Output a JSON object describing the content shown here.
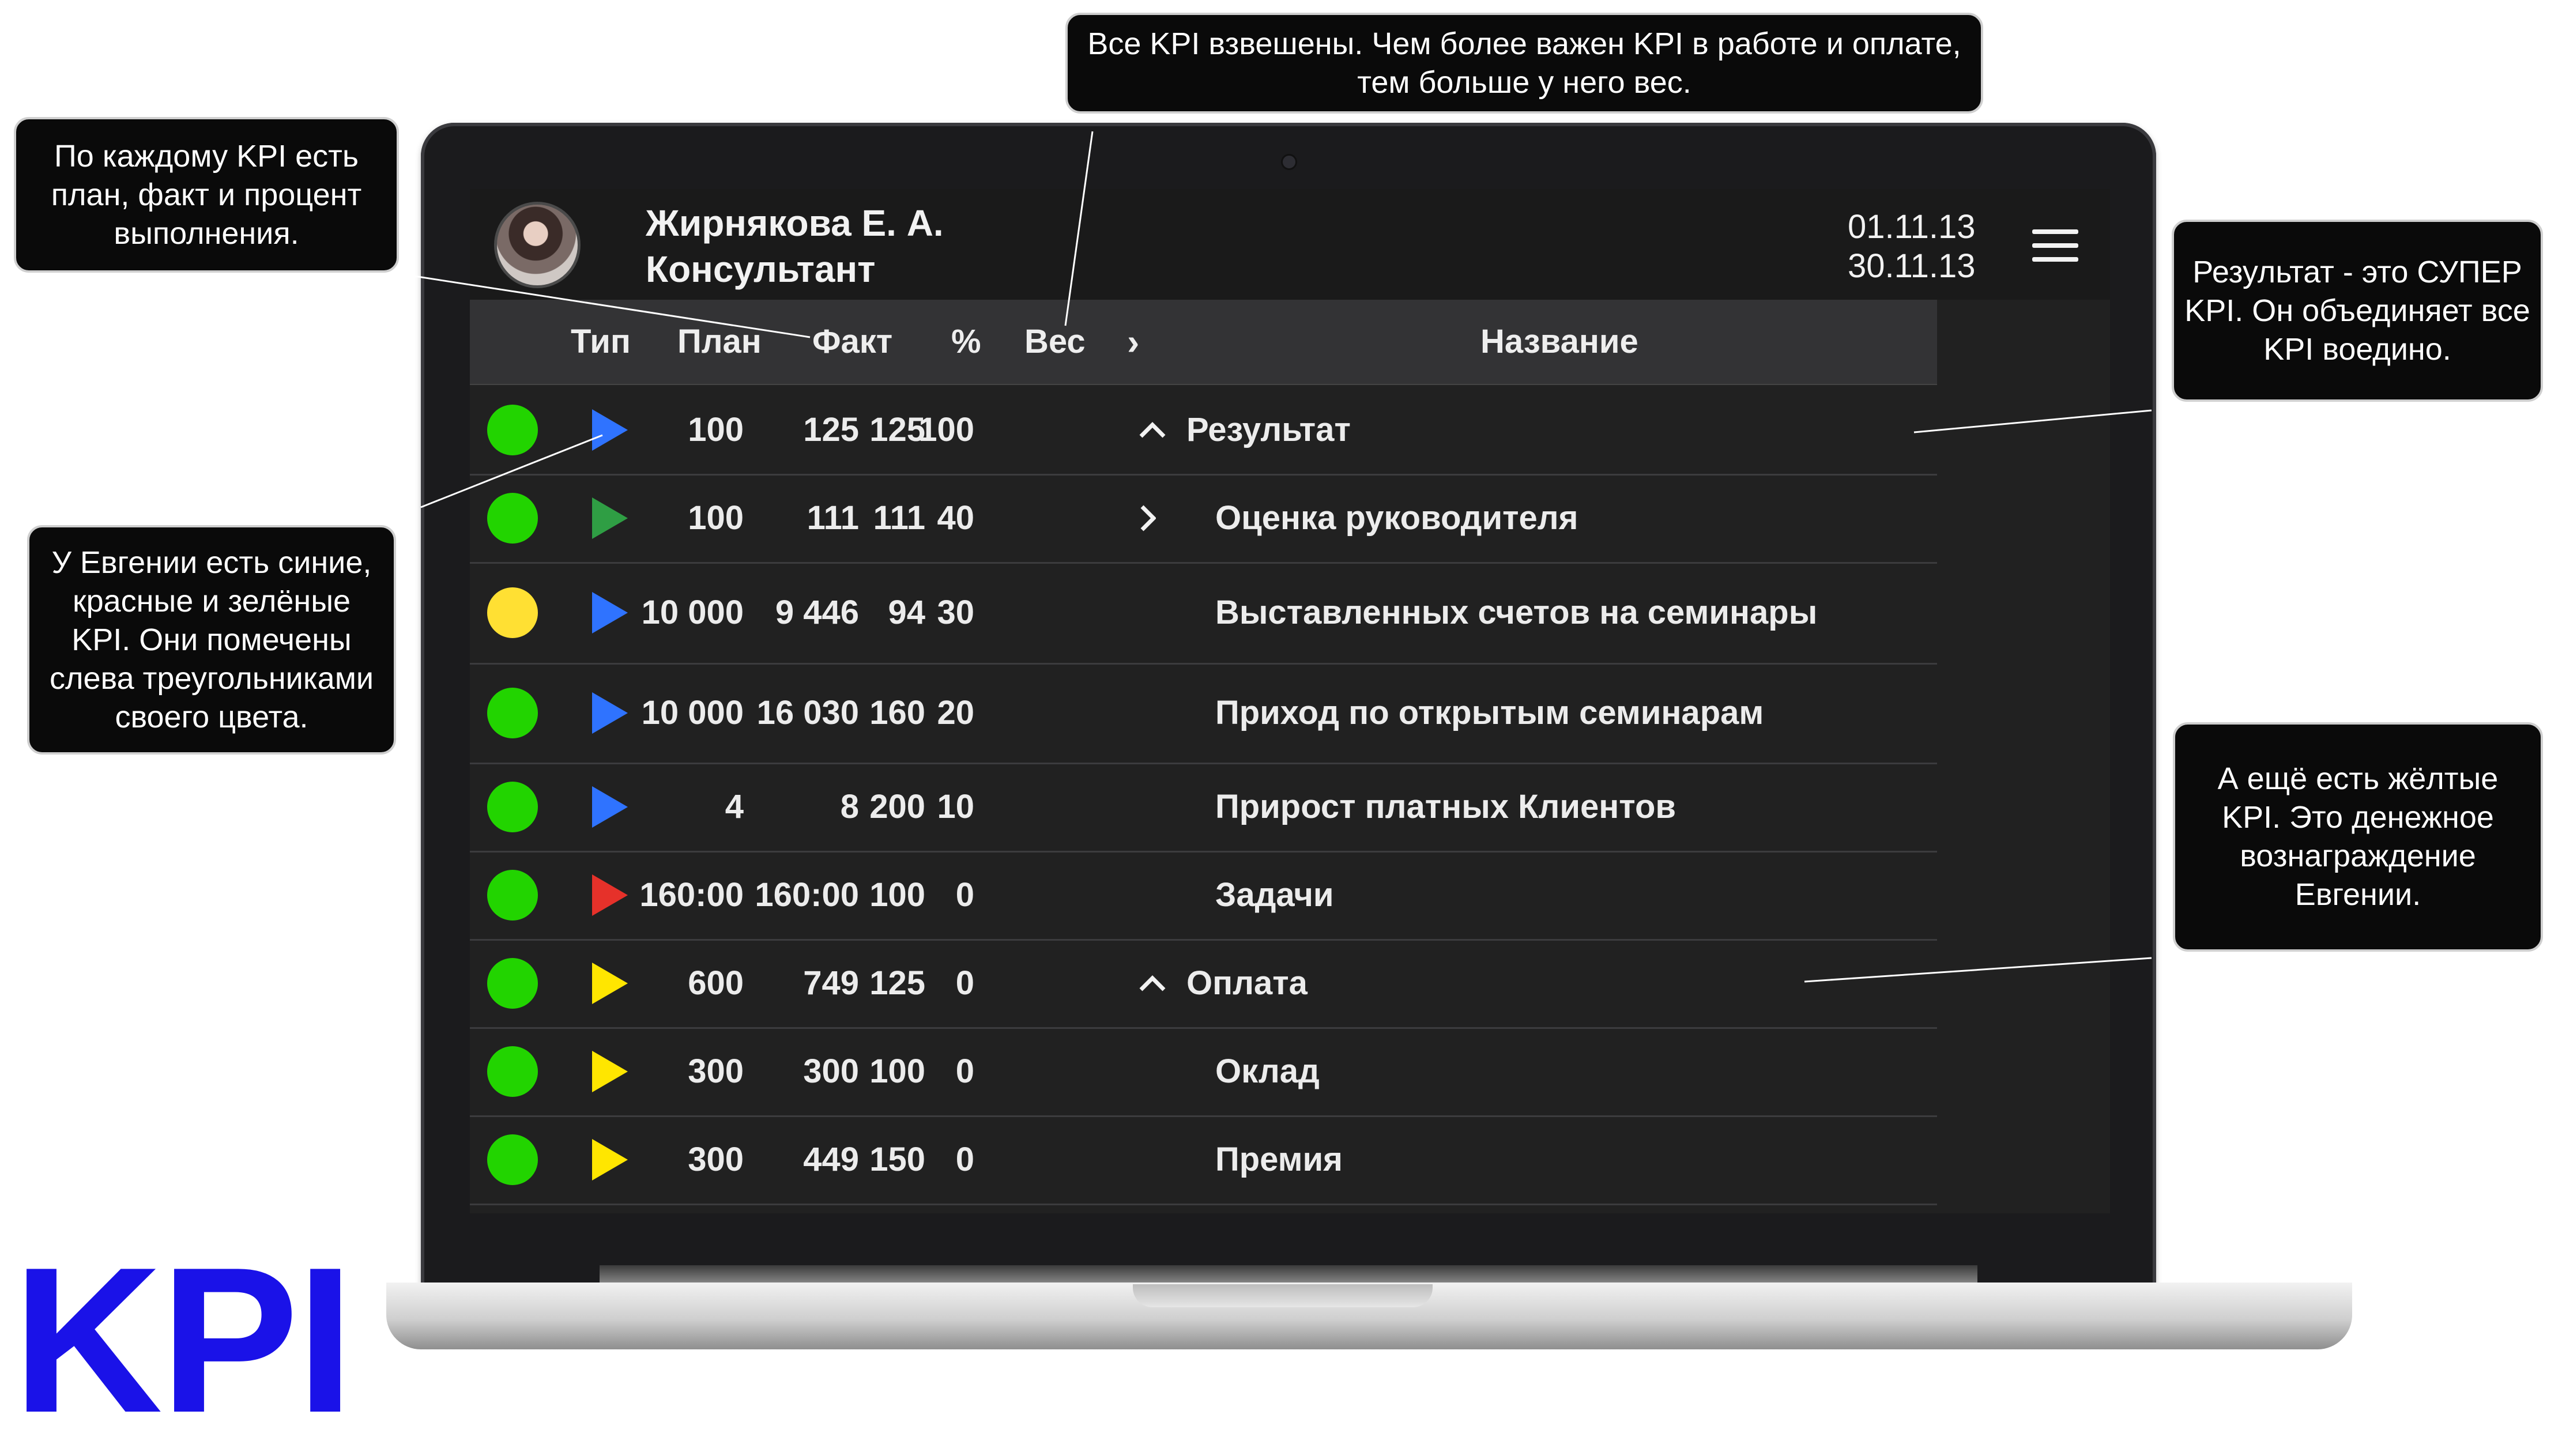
{
  "header": {
    "user_name": "Жирнякова Е. А.",
    "user_role": "Консультант",
    "date_from": "01.11.13",
    "date_to": "30.11.13",
    "menu_icon": "hamburger-menu-icon"
  },
  "columns": {
    "type": "Тип",
    "plan": "План",
    "fact": "Факт",
    "percent": "%",
    "weight": "Вес",
    "name": "Название"
  },
  "colors": {
    "green": "#22d400",
    "yellow": "#ffe033",
    "blue": "#2f73ff",
    "dark_green": "#2f9e44",
    "red": "#e6312a",
    "kpi_yellow": "#ffe600",
    "logo_blue": "#1a12e8"
  },
  "rows": [
    {
      "status": "green",
      "type": "blue",
      "plan": "100",
      "fact": "125",
      "percent": "125",
      "weight": "100",
      "chevron": "^",
      "name": "Результат",
      "indent": false
    },
    {
      "status": "green",
      "type": "dark_green",
      "plan": "100",
      "fact": "111",
      "percent": "111",
      "weight": "40",
      "chevron": ">",
      "name": "Оценка руководителя",
      "indent": true
    },
    {
      "status": "yellow",
      "type": "blue",
      "plan": "10 000",
      "fact": "9 446",
      "percent": "94",
      "weight": "30",
      "chevron": "",
      "name": "Выставленных счетов на семинары",
      "indent": true
    },
    {
      "status": "green",
      "type": "blue",
      "plan": "10 000",
      "fact": "16 030",
      "percent": "160",
      "weight": "20",
      "chevron": "",
      "name": "Приход по открытым семинарам",
      "indent": true
    },
    {
      "status": "green",
      "type": "blue",
      "plan": "4",
      "fact": "8",
      "percent": "200",
      "weight": "10",
      "chevron": "",
      "name": "Прирост платных Клиентов",
      "indent": true
    },
    {
      "status": "green",
      "type": "red",
      "plan": "160:00",
      "fact": "160:00",
      "percent": "100",
      "weight": "0",
      "chevron": "",
      "name": "Задачи",
      "indent": true
    },
    {
      "status": "green",
      "type": "kpi_yellow",
      "plan": "600",
      "fact": "749",
      "percent": "125",
      "weight": "0",
      "chevron": "^",
      "name": "Оплата",
      "indent": false
    },
    {
      "status": "green",
      "type": "kpi_yellow",
      "plan": "300",
      "fact": "300",
      "percent": "100",
      "weight": "0",
      "chevron": "",
      "name": "Оклад",
      "indent": true
    },
    {
      "status": "green",
      "type": "kpi_yellow",
      "plan": "300",
      "fact": "449",
      "percent": "150",
      "weight": "0",
      "chevron": "",
      "name": "Премия",
      "indent": true
    }
  ],
  "callouts": {
    "weights": "Все KPI взвешены. Чем более важен KPI в работе и оплате, тем больше у него вес.",
    "plan_fact": "По каждому KPI есть план, факт и процент выполнения.",
    "colors": "У Евгении есть синие, красные и зелёные KPI. Они помечены слева треугольниками своего цвета.",
    "result": "Результат - это СУПЕР KPI. Он объединяет все KPI воедино.",
    "yellow": "А ещё есть жёлтые KPI. Это денежное вознаграждение Евгении."
  },
  "logo": "KPI"
}
